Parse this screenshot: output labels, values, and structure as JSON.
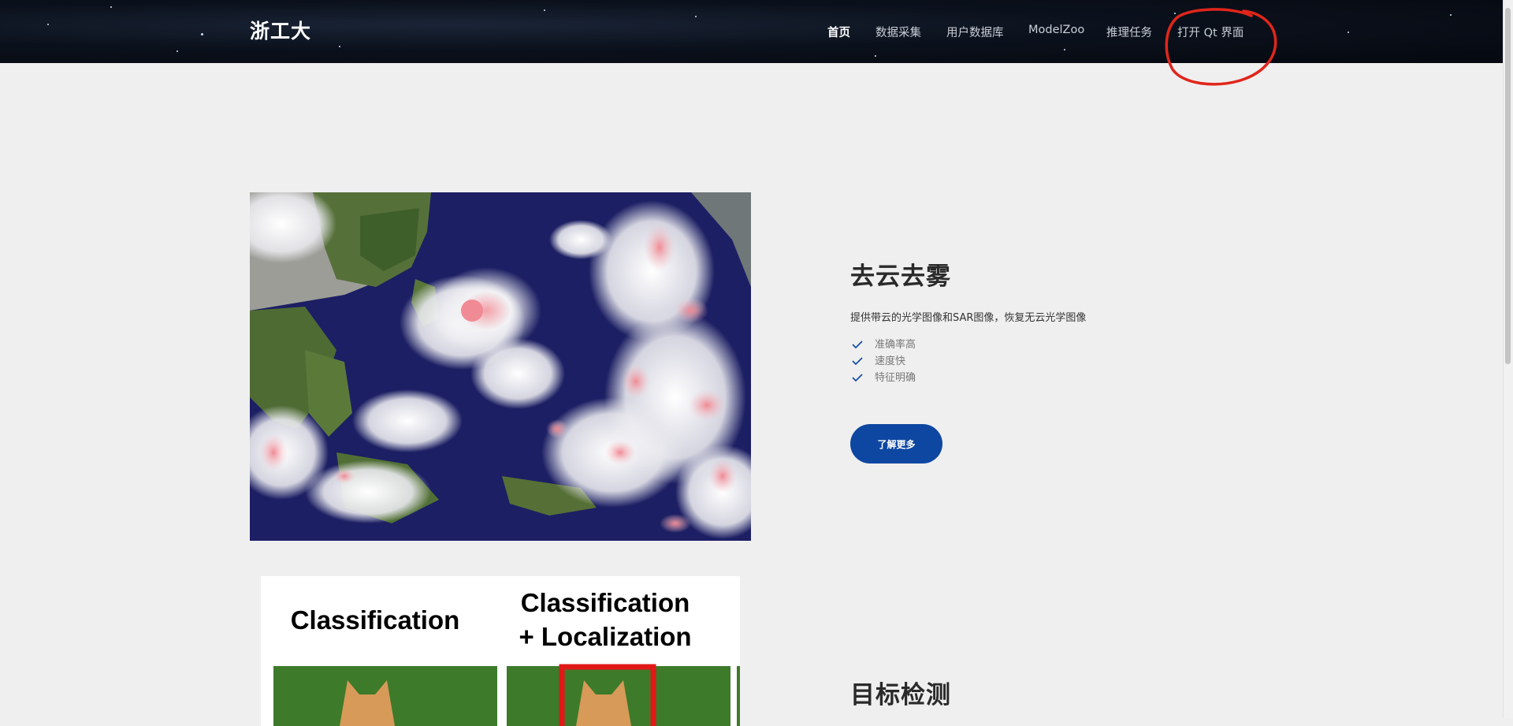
{
  "header": {
    "brand": "浙工大",
    "nav": [
      {
        "label": "首页",
        "active": true
      },
      {
        "label": "数据采集",
        "active": false
      },
      {
        "label": "用户数据库",
        "active": false
      },
      {
        "label": "ModelZoo",
        "active": false
      },
      {
        "label": "推理任务",
        "active": false
      },
      {
        "label": "打开 Qt 界面",
        "active": false
      }
    ],
    "annotation_color": "#e0261b"
  },
  "features": [
    {
      "title": "去云去雾",
      "description": "提供带云的光学图像和SAR图像，恢复无云光学图像",
      "points": [
        "准确率高",
        "速度快",
        "特征明确"
      ],
      "button_label": "了解更多"
    },
    {
      "title": "目标检测",
      "image_text": [
        "Classification",
        "Classification",
        "+ Localization"
      ]
    }
  ],
  "colors": {
    "accent": "#0d47a1",
    "check": "#0d47a1",
    "page_bg": "#efeff0",
    "header_bg": "#0b111c"
  }
}
